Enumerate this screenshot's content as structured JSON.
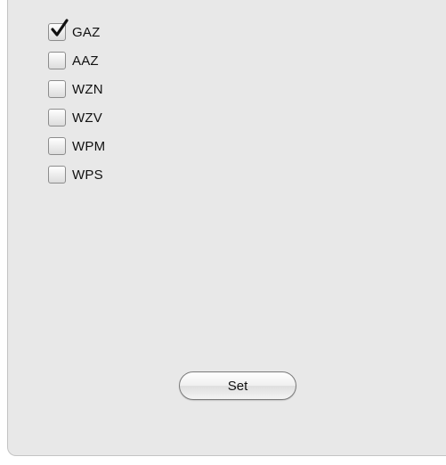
{
  "options": [
    {
      "label": "GAZ",
      "checked": true
    },
    {
      "label": "AAZ",
      "checked": false
    },
    {
      "label": "WZN",
      "checked": false
    },
    {
      "label": "WZV",
      "checked": false
    },
    {
      "label": "WPM",
      "checked": false
    },
    {
      "label": "WPS",
      "checked": false
    }
  ],
  "set_button": {
    "label": "Set"
  },
  "colors": {
    "panel_bg": "#e8e8e8",
    "check_mark": "#111111"
  }
}
